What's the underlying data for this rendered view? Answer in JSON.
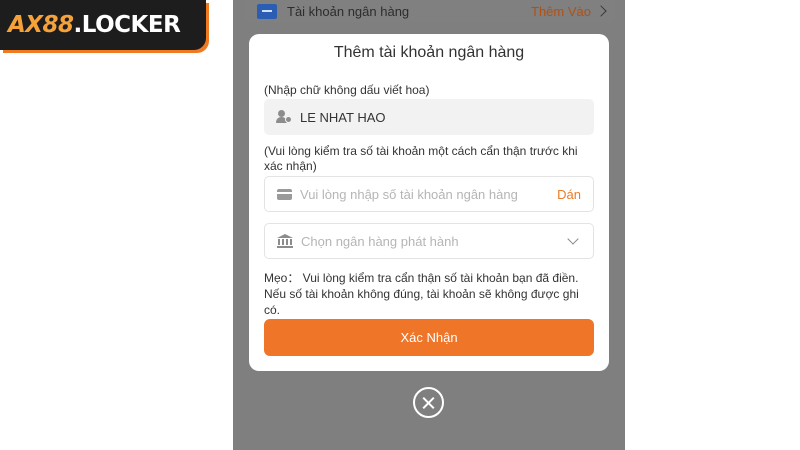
{
  "brand": {
    "logo_prefix": "AX88",
    "logo_suffix": ".LOCKER",
    "accent_color": "#ef7528"
  },
  "background_row": {
    "label": "Tài khoản ngân hàng",
    "action": "Thêm Vào",
    "icon": "bank-card-icon"
  },
  "modal": {
    "title": "Thêm tài khoản ngân hàng",
    "name_hint": "(Nhập chữ không dấu viết hoa)",
    "name_value": "LE NHAT HAO",
    "name_icon": "user-verified-icon",
    "account_hint": "(Vui lòng kiểm tra số tài khoản một cách cẩn thận trước khi xác nhận)",
    "account_placeholder": "Vui lòng nhập số tài khoản ngân hàng",
    "account_icon": "card-icon",
    "paste_label": "Dán",
    "bank_placeholder": "Chọn ngân hàng phát hành",
    "bank_icon": "bank-icon",
    "tip": "Mẹo： Vui lòng kiểm tra cẩn thận số tài khoản bạn đã điền. Nếu số tài khoản không đúng, tài khoản sẽ không được ghi có.",
    "confirm_label": "Xác Nhận"
  }
}
